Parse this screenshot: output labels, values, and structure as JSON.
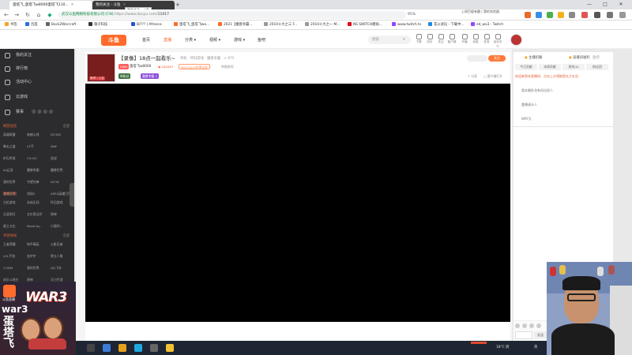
{
  "browser": {
    "tabs": [
      {
        "label": "蛋塔飞_蛋塔飞w8000蛋塔飞110..."
      },
      {
        "label": "我的关注 - 斗鱼"
      }
    ],
    "new_tab_symbol": "+",
    "tooltip": "我的关注 - 斗鱼",
    "url_secure_text": "武汉斗鱼网络科技有限公司 [CN]",
    "url_domain": "https://www.douyu.com/",
    "url_path": "11017",
    "zoom": "95%",
    "top_note": "上网百般有趣 | 我的浏览器",
    "bookmarks": [
      "书签",
      "百度",
      "Back2Warcraft",
      "锤子科技",
      "B/??? | Afreeca",
      "蛋塔飞_蛋塔飞wo...",
      "2021【魔兽争霸...",
      "2010十大之三 F...",
      "2010十大之一 M...",
      "NS SWITCH模拟...",
      "www.twitch.tv",
      "花火试玩 - 下载中...",
      "ed_wo3 - Twitch"
    ],
    "window_controls": [
      "—",
      "□",
      "✕"
    ]
  },
  "douyu_header": {
    "logo_text": "斗鱼",
    "nav": [
      "首页",
      "直播",
      "分类",
      "视频",
      "游戏",
      "鱼吧"
    ],
    "active_nav": "直播",
    "search_placeholder": "搜索",
    "header_icons": [
      "下载",
      "历史",
      "关注",
      "客户端",
      "开播",
      "消息",
      "任务",
      "创作中心"
    ]
  },
  "sidebar": {
    "items": [
      "我的关注",
      "排行榜",
      "活动中心",
      "云游戏",
      "赛事"
    ],
    "sections": [
      {
        "title": "网游竞技",
        "more": "全部",
        "games": [
          "英雄联盟",
          "穿越火线",
          "DOTA2",
          "拳击之道",
          "CF手",
          "DNF",
          "炉石传说",
          "CS:GO",
          "逆战",
          "lol云顶",
          "魔兽争霸",
          "魔兽世界",
          "我的世界",
          "守望先锋",
          "DOTA",
          "魔兽世界",
          "剑网3",
          "APEX英雄"
        ]
      },
      {
        "title": "单机热游",
        "more": "全部",
        "games": [
          "主机游戏",
          "永劫无间",
          "怀旧游戏",
          "天涯明月",
          "艾尔登法环",
          "原神",
          "星之卡比",
          "Dead by..",
          "小镇叫..."
        ]
      },
      {
        "title": "手游休闲",
        "more": "全部",
        "games": [
          "王者荣耀",
          "和平精英",
          "火影忍者",
          "LOL手游",
          "金铲铲",
          "第五人格",
          "CODM",
          "我的世界",
          "QQ飞车",
          "欢乐斗地主",
          "原神",
          "天刀手游",
          "CF手游",
          "狼人杀",
          "新游推荐"
        ]
      }
    ]
  },
  "streamer_badge": {
    "platform": "斗鱼直播",
    "title_a": "WAR3",
    "title_b": "war3",
    "name": "蛋塔飞"
  },
  "anchor": {
    "avatar_tag": "鱼吧 | 公会",
    "room_title": "【录像】18点一起看乐~",
    "category": "单机 · 怀旧游戏 · 魔兽争霸 · > 975",
    "level_chip": "LV60",
    "name": "蛋塔飞w8000",
    "room_id": "284487",
    "badge_chip": "WCG2010世界冠军",
    "report": "举报房间",
    "tags": [
      "带粉丝",
      "魔兽争霸 3"
    ],
    "follow_label": "关注",
    "share": "分享",
    "client": "客户端打开"
  },
  "chat": {
    "tabs": [
      "主播招募",
      "直播间福利",
      "鱼吧",
      "粉丝团"
    ],
    "rank_tabs": [
      "今日贡献",
      "本周贡献",
      "贵宾(0)",
      "粉丝团"
    ],
    "notice": "欢迎来到本直播间，点击上方领取鱼丸大礼包",
    "lines": [
      "我本最卧龙有凤出现人",
      "重播请头人",
      "WRY天"
    ],
    "send_label": "发送"
  },
  "taskbar": {
    "weather": "18°C 阴",
    "tray": "英"
  }
}
